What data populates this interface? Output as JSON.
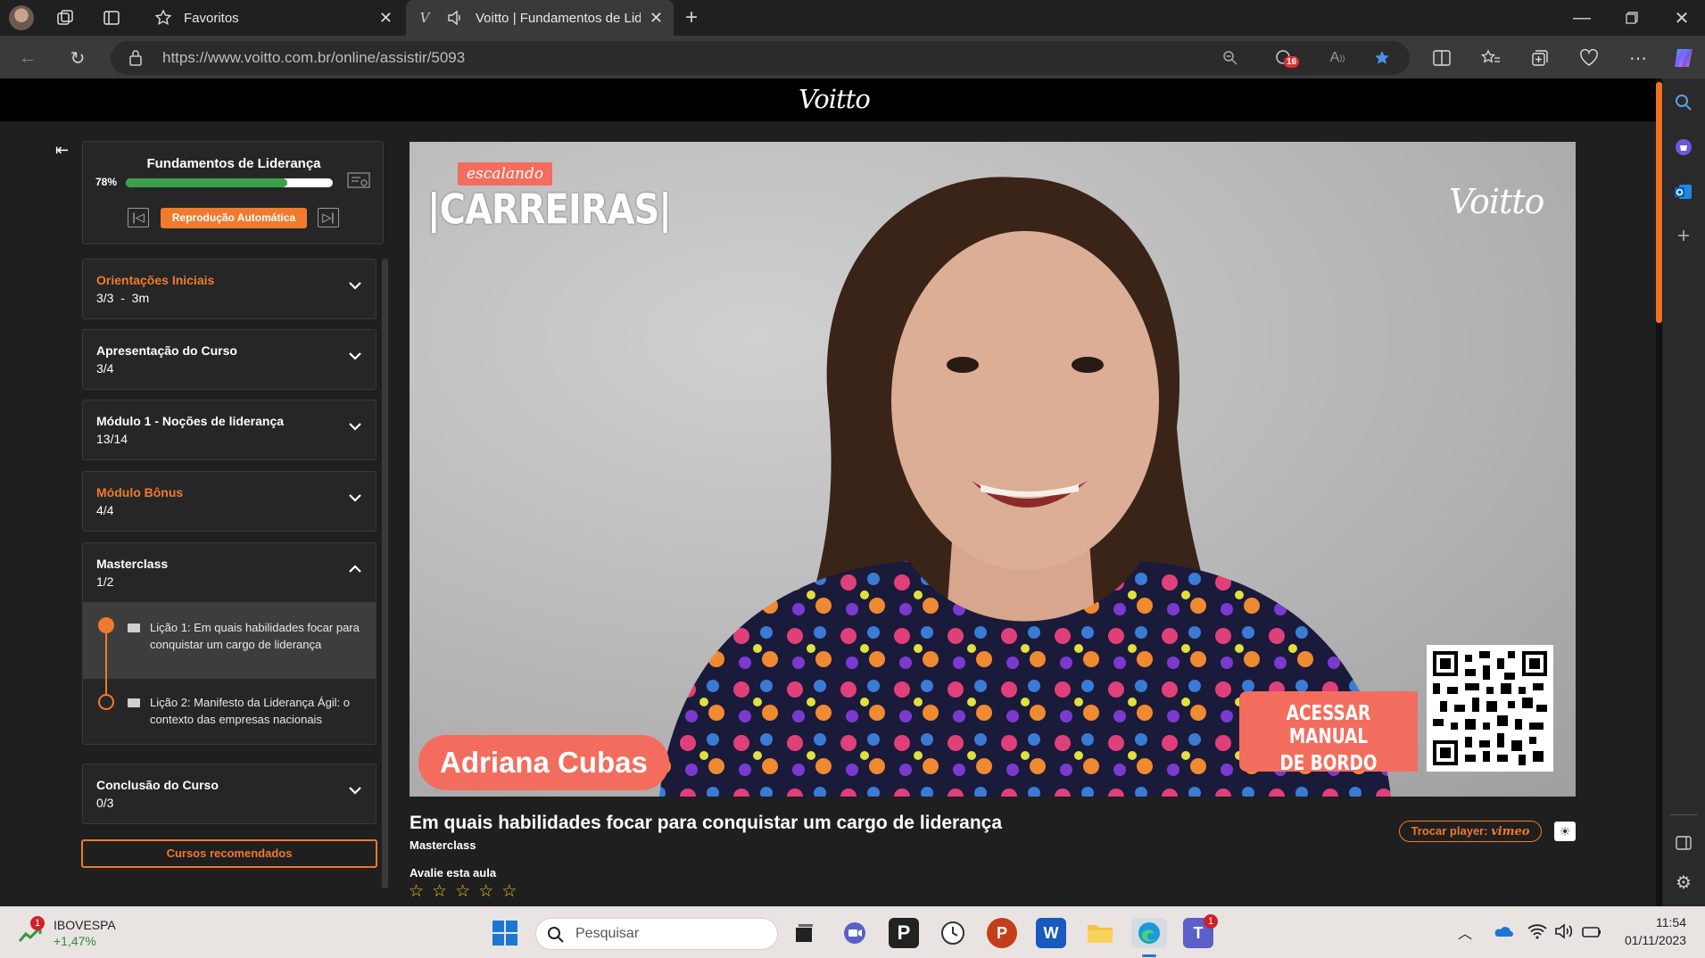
{
  "browser": {
    "tabs": [
      {
        "label": "Favoritos"
      },
      {
        "label": "Voitto | Fundamentos de Lid"
      }
    ],
    "url": "https://www.voitto.com.br/online/assistir/5093",
    "badge_count": "16"
  },
  "site": {
    "logo": "Voitto"
  },
  "course": {
    "title": "Fundamentos de Liderança",
    "progress_label": "78%",
    "progress_value": 0.78,
    "autoplay_label": "Reprodução Automática",
    "modules": [
      {
        "title": "Orientações Iniciais",
        "count": "3/3  -  3m"
      },
      {
        "title": "Apresentação do Curso",
        "count": "3/4"
      },
      {
        "title": "Módulo 1 - Noções de liderança",
        "count": "13/14"
      },
      {
        "title": "Módulo Bônus",
        "count": "4/4"
      },
      {
        "title": "Masterclass",
        "count": "1/2"
      },
      {
        "title": "Conclusão do Curso",
        "count": "0/3"
      }
    ],
    "lessons": [
      {
        "title": "Lição 1: Em quais habilidades focar para conquistar um cargo de liderança"
      },
      {
        "title": "Lição 2: Manifesto da Liderança Ágil: o contexto das empresas nacionais"
      }
    ],
    "recommended_label": "Cursos recomendados"
  },
  "video": {
    "overlay_top_small": "escalando",
    "overlay_top_big": "|CARREIRAS|",
    "watermark": "Voitto",
    "speaker": "Adriana Cubas",
    "cta_line1": "ACESSAR MANUAL",
    "cta_line2": "DE BORDO"
  },
  "lesson_info": {
    "title": "Em quais habilidades focar para conquistar um cargo de liderança",
    "module": "Masterclass",
    "rate_label": "Avalie esta aula",
    "rating": 0,
    "max_rating": 5,
    "switch_player_label": "Trocar player:",
    "player_name": "vimeo"
  },
  "taskbar": {
    "stock_name": "IBOVESPA",
    "stock_change": "+1,47%",
    "stock_badge": "1",
    "search_placeholder": "Pesquisar",
    "teams_badge": "1",
    "time": "11:54",
    "date": "01/11/2023"
  }
}
